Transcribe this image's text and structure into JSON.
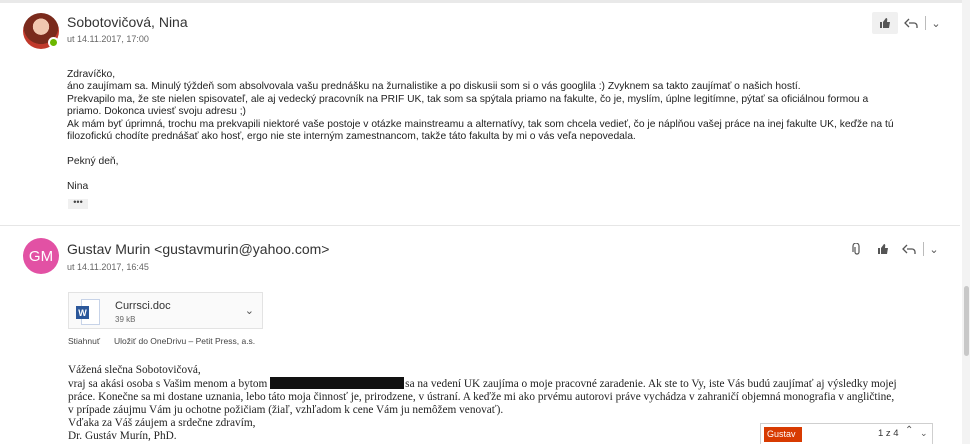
{
  "message1": {
    "sender": "Sobotovičová, Nina",
    "date": "ut 14.11.2017, 17:00",
    "body": [
      "Zdravíčko,",
      "áno zaujímam sa. Minulý týždeň som absolvovala vašu prednášku na žurnalistike a po diskusii som si o vás googlila :) Zvyknem sa takto zaujímať o našich hostí.",
      "Prekvapilo ma, že ste nielen spisovateľ, ale aj vedecký pracovník na PRIF UK, tak som sa spýtala priamo na fakulte, čo je, myslím, úplne legitímne, pýtať sa oficiálnou formou a",
      "priamo. Dokonca uviesť svoju adresu ;)",
      "Ak mám byť úprimná, trochu ma prekvapili niektoré vaše postoje v otázke mainstreamu a alternatívy, tak som chcela vedieť, čo je náplňou vašej práce na inej fakulte UK, keďže na tú",
      "filozofickú chodíte prednášať ako hosť, ergo nie ste interným zamestnancom, takže táto fakulta by mi o vás veľa nepovedala.",
      "",
      "Pekný deň,",
      "",
      "Nina"
    ],
    "more": "•••"
  },
  "message2": {
    "avatar_initials": "GM",
    "sender": "Gustav Murin <gustavmurin@yahoo.com>",
    "date": "ut 14.11.2017, 16:45",
    "attachment": {
      "name": "Currsci.doc",
      "size": "39 kB",
      "badge": "W"
    },
    "attachment_links": {
      "download": "Stiahnuť",
      "save": "Uložiť do OneDrivu – Petit Press, a.s."
    },
    "body": {
      "greeting": "Vážená slečna Sobotovičová,",
      "line1_pre": "vraj sa akási osoba s Vašim menom a bytom",
      "line1_post": "sa na vedení UK zaujíma o moje pracovné zaradenie. Ak ste to Vy, iste Vás budú zaujímať aj výsledky mojej",
      "line2": "práce. Konečne sa mi dostane uznania, lebo táto moja činnosť je, prirodzene, v ústraní. A keďže mi ako prvému autorovi práve vychádza v zahraničí objemná monografia v angličtine,",
      "line3": "v prípade záujmu Vám ju ochotne požičiam (žiaľ, vzhľadom k cene Vám ju nemôžem venovať).",
      "line4": "Vďaka za Váš záujem a srdečne zdravím,",
      "line5": "Dr. Gustáv Murín, PhD."
    }
  },
  "chat": {
    "name": "Gustav",
    "count": "1 z 4"
  },
  "icons": {
    "like": "like-icon",
    "reply": "reply-all-icon",
    "more": "chevron-down-icon",
    "attachment": "paperclip-icon"
  },
  "colors": {
    "avatar_gm": "#e251a4",
    "presence": "#6bb700",
    "chat_tab": "#d83b01",
    "word": "#2b579a"
  }
}
